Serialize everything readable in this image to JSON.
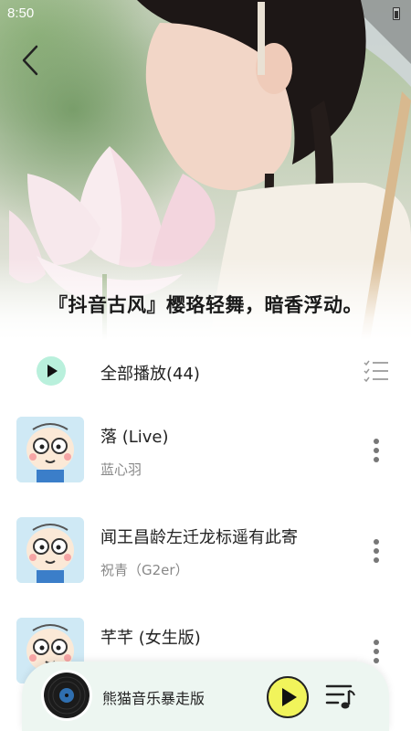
{
  "status_bar": {
    "time": "8:50"
  },
  "header": {
    "playlist_title": "『抖音古风』樱珞轻舞，暗香浮动。"
  },
  "play_all": {
    "label": "全部播放(44)"
  },
  "songs": [
    {
      "title": "落 (Live)",
      "artist": "蓝心羽"
    },
    {
      "title": "闻王昌龄左迁龙标遥有此寄",
      "artist": "祝青（G2er）"
    },
    {
      "title": "芊芊 (女生版)",
      "artist": ""
    }
  ],
  "mini_player": {
    "name": "熊猫音乐暴走版"
  },
  "colors": {
    "play_all_accent": "#b9f0dc",
    "player_play_button": "#f1f45b",
    "mini_player_bg": "#edf6f1"
  },
  "icons": {
    "back": "chevron-left-icon",
    "play_all": "play-icon",
    "multi_select": "checklist-icon",
    "more": "more-vertical-icon",
    "queue": "playlist-icon"
  }
}
